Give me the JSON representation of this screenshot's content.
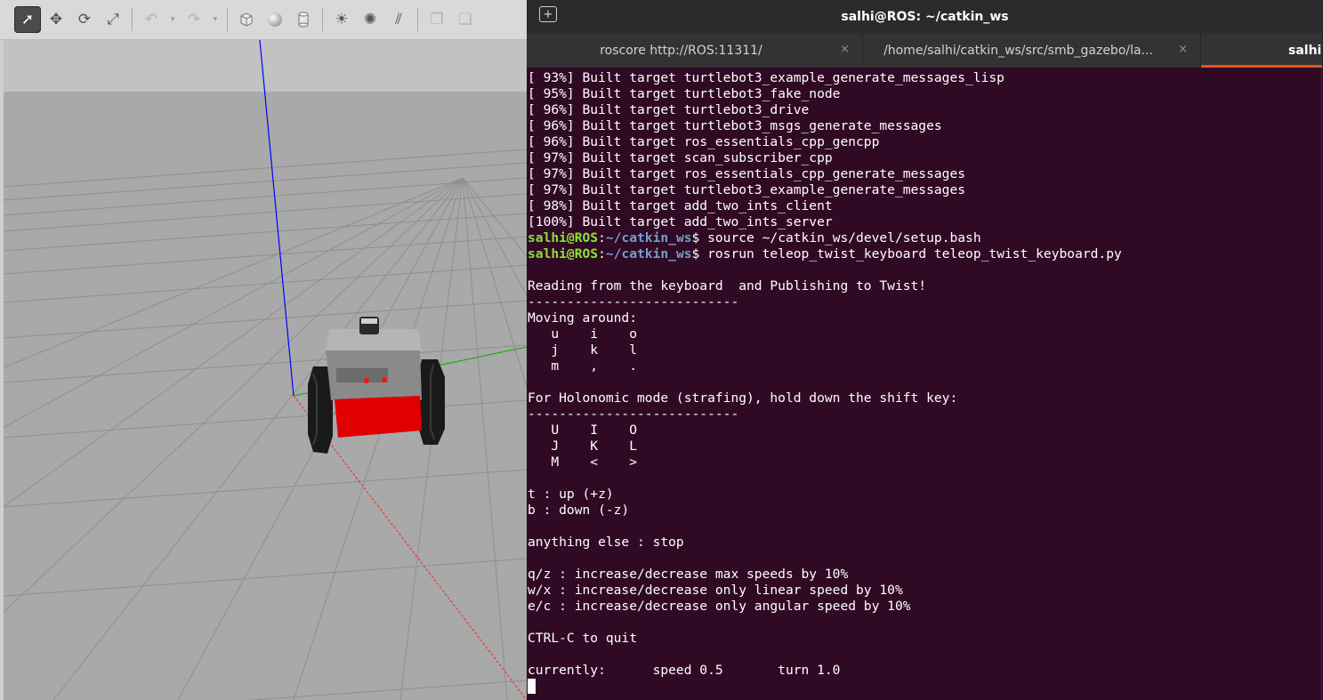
{
  "gazebo": {
    "toolbar": [
      {
        "icon": "select-arrow-icon",
        "glyph": "➚",
        "active": true
      },
      {
        "icon": "translate-icon",
        "glyph": "✥"
      },
      {
        "icon": "rotate-icon",
        "glyph": "⟳"
      },
      {
        "icon": "scale-icon",
        "glyph": "⤢"
      },
      {
        "icon": "undo-icon",
        "glyph": "↶",
        "dim": true
      },
      {
        "icon": "redo-icon",
        "glyph": "↷",
        "dim": true
      },
      {
        "icon": "box-shape-icon"
      },
      {
        "icon": "sphere-shape-icon"
      },
      {
        "icon": "cylinder-shape-icon"
      },
      {
        "icon": "point-light-icon",
        "glyph": "☀"
      },
      {
        "icon": "spot-light-icon",
        "glyph": "✺"
      },
      {
        "icon": "directional-light-icon",
        "glyph": "⫽"
      },
      {
        "icon": "copy-icon",
        "glyph": "❐",
        "dim": true
      },
      {
        "icon": "paste-icon",
        "glyph": "❏",
        "dim": true
      }
    ],
    "colors": {
      "sky": "#c2c2c2",
      "ground": "#a9a9a9",
      "grid": "#8f8f8f",
      "robot_body": "#7d7d7d",
      "robot_bumper": "#e00000",
      "axis_z": "#0000ff",
      "axis_x": "#ff0000",
      "axis_y": "#00bb00"
    }
  },
  "terminal": {
    "title": "salhi@ROS: ~/catkin_ws",
    "tabs": [
      {
        "label": "roscore http://ROS:11311/",
        "close": "×"
      },
      {
        "label": "/home/salhi/catkin_ws/src/smb_gazebo/la...",
        "close": "×"
      },
      {
        "label": "salhi@",
        "active": true
      }
    ],
    "prompt": {
      "user": "salhi@ROS",
      "sep": ":",
      "path": "~/catkin_ws",
      "dollar": "$"
    },
    "lines": [
      {
        "text": "[ 93%] Built target turtlebot3_example_generate_messages_lisp"
      },
      {
        "text": "[ 95%] Built target turtlebot3_fake_node"
      },
      {
        "text": "[ 96%] Built target turtlebot3_drive"
      },
      {
        "text": "[ 96%] Built target turtlebot3_msgs_generate_messages"
      },
      {
        "text": "[ 96%] Built target ros_essentials_cpp_gencpp"
      },
      {
        "text": "[ 97%] Built target scan_subscriber_cpp"
      },
      {
        "text": "[ 97%] Built target ros_essentials_cpp_generate_messages"
      },
      {
        "text": "[ 97%] Built target turtlebot3_example_generate_messages"
      },
      {
        "text": "[ 98%] Built target add_two_ints_client"
      },
      {
        "text": "[100%] Built target add_two_ints_server"
      },
      {
        "cmd": " source ~/catkin_ws/devel/setup.bash"
      },
      {
        "cmd": " rosrun teleop_twist_keyboard teleop_twist_keyboard.py"
      },
      {
        "text": ""
      },
      {
        "text": "Reading from the keyboard  and Publishing to Twist!"
      },
      {
        "text": "---------------------------"
      },
      {
        "text": "Moving around:"
      },
      {
        "text": "   u    i    o"
      },
      {
        "text": "   j    k    l"
      },
      {
        "text": "   m    ,    ."
      },
      {
        "text": ""
      },
      {
        "text": "For Holonomic mode (strafing), hold down the shift key:"
      },
      {
        "text": "---------------------------"
      },
      {
        "text": "   U    I    O"
      },
      {
        "text": "   J    K    L"
      },
      {
        "text": "   M    <    >"
      },
      {
        "text": ""
      },
      {
        "text": "t : up (+z)"
      },
      {
        "text": "b : down (-z)"
      },
      {
        "text": ""
      },
      {
        "text": "anything else : stop"
      },
      {
        "text": ""
      },
      {
        "text": "q/z : increase/decrease max speeds by 10%"
      },
      {
        "text": "w/x : increase/decrease only linear speed by 10%"
      },
      {
        "text": "e/c : increase/decrease only angular speed by 10%"
      },
      {
        "text": ""
      },
      {
        "text": "CTRL-C to quit"
      },
      {
        "text": ""
      },
      {
        "text": "currently:      speed 0.5       turn 1.0 "
      },
      {
        "cursor": true
      }
    ],
    "colors": {
      "background": "#300a24",
      "prompt_user": "#8ae234",
      "prompt_path": "#729fcf",
      "active_tab_accent": "#e95420"
    }
  }
}
